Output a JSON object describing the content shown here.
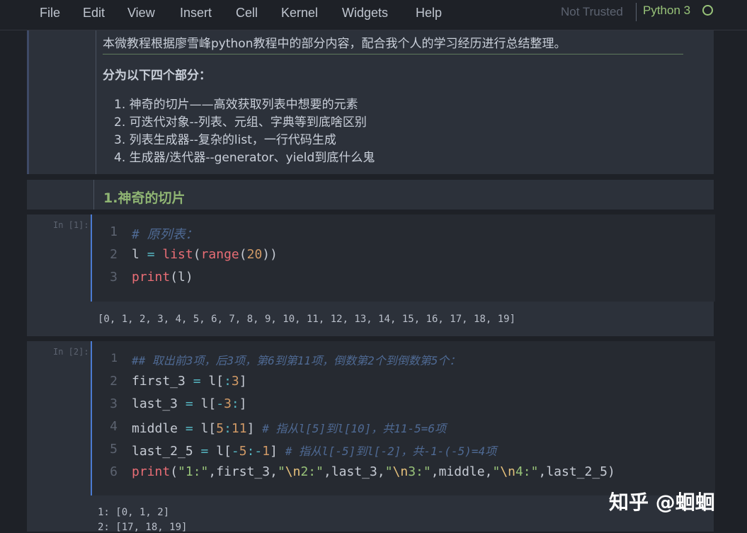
{
  "menubar": {
    "items": [
      "File",
      "Edit",
      "View",
      "Insert",
      "Cell",
      "Kernel",
      "Widgets",
      "Help"
    ],
    "trust_status": "Not Trusted",
    "kernel_name": "Python 3"
  },
  "intro_cell": {
    "paragraph": "本微教程根据廖雪峰python教程中的部分内容，配合我个人的学习经历进行总结整理。",
    "subheading": "分为以下四个部分：",
    "list": [
      "神奇的切片——高效获取列表中想要的元素",
      "可迭代对象--列表、元组、字典等到底啥区别",
      "列表生成器--复杂的list，一行代码生成",
      "生成器/迭代器--generator、yield到底什么鬼"
    ]
  },
  "heading_cell": {
    "text": "1.神奇的切片"
  },
  "code_cell_1": {
    "prompt": "In [1]:",
    "lines": [
      "# 原列表：",
      "l = list(range(20))",
      "print(l)"
    ],
    "output": "[0, 1, 2, 3, 4, 5, 6, 7, 8, 9, 10, 11, 12, 13, 14, 15, 16, 17, 18, 19]"
  },
  "code_cell_2": {
    "prompt": "In [2]:",
    "lines": [
      "## 取出前3项，后3项，第6到第11项，倒数第2个到倒数第5个：",
      "first_3 = l[:3]",
      "last_3 = l[-3:]",
      "middle = l[5:11] # 指从l[5]到l[10]，共11-5=6项",
      "last_2_5 = l[-5:-1] # 指从l[-5]到l[-2]，共-1-(-5)=4项",
      "print(\"1:\",first_3,\"\\n2:\",last_3,\"\\n3:\",middle,\"\\n4:\",last_2_5)"
    ],
    "output": [
      "1: [0, 1, 2]",
      "2: [17, 18, 19]"
    ]
  },
  "watermark": "知乎 @蛔蛔"
}
